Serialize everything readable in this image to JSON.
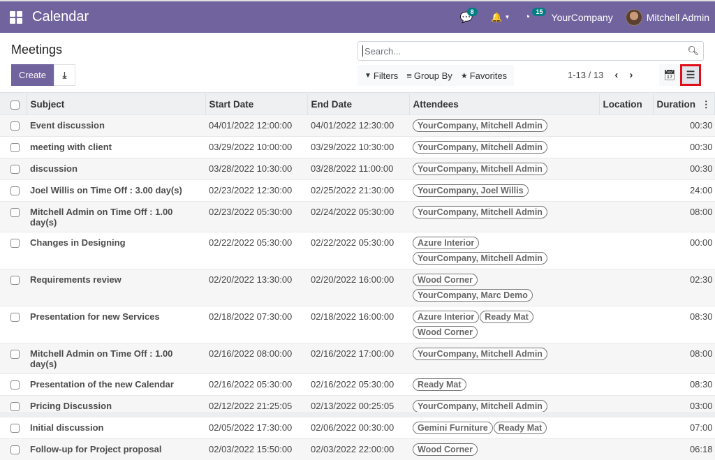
{
  "navbar": {
    "app_title": "Calendar",
    "messages_count": "8",
    "activities_count": "15",
    "company": "YourCompany",
    "user": "Mitchell Admin"
  },
  "control_panel": {
    "breadcrumb": "Meetings",
    "create_label": "Create",
    "search_placeholder": "Search...",
    "filters_label": "Filters",
    "group_by_label": "Group By",
    "favorites_label": "Favorites",
    "pager": "1-13 / 13",
    "active_view": "list"
  },
  "table": {
    "columns": [
      "Subject",
      "Start Date",
      "End Date",
      "Attendees",
      "Location",
      "Duration"
    ],
    "rows": [
      {
        "subject": "Event discussion",
        "start": "04/01/2022 12:00:00",
        "end": "04/01/2022 12:30:00",
        "attendees": [
          "YourCompany, Mitchell Admin"
        ],
        "location": "",
        "duration": "00:30"
      },
      {
        "subject": "meeting with client",
        "start": "03/29/2022 10:00:00",
        "end": "03/29/2022 10:30:00",
        "attendees": [
          "YourCompany, Mitchell Admin"
        ],
        "location": "",
        "duration": "00:30"
      },
      {
        "subject": "discussion",
        "start": "03/28/2022 10:30:00",
        "end": "03/28/2022 11:00:00",
        "attendees": [
          "YourCompany, Mitchell Admin"
        ],
        "location": "",
        "duration": "00:30"
      },
      {
        "subject": "Joel Willis on Time Off : 3.00 day(s)",
        "start": "02/23/2022 12:30:00",
        "end": "02/25/2022 21:30:00",
        "attendees": [
          "YourCompany, Joel Willis"
        ],
        "location": "",
        "duration": "24:00"
      },
      {
        "subject": "Mitchell Admin on Time Off : 1.00 day(s)",
        "start": "02/23/2022 05:30:00",
        "end": "02/24/2022 05:30:00",
        "attendees": [
          "YourCompany, Mitchell Admin"
        ],
        "location": "",
        "duration": "08:00"
      },
      {
        "subject": "Changes in Designing",
        "start": "02/22/2022 05:30:00",
        "end": "02/22/2022 05:30:00",
        "attendees": [
          "Azure Interior",
          "YourCompany, Mitchell Admin"
        ],
        "wrap": true,
        "location": "",
        "duration": "00:00"
      },
      {
        "subject": "Requirements review",
        "start": "02/20/2022 13:30:00",
        "end": "02/20/2022 16:00:00",
        "attendees": [
          "Wood Corner",
          "YourCompany, Marc Demo"
        ],
        "location": "",
        "duration": "02:30"
      },
      {
        "subject": "Presentation for new Services",
        "start": "02/18/2022 07:30:00",
        "end": "02/18/2022 16:00:00",
        "attendees": [
          "Azure Interior",
          "Ready Mat",
          "Wood Corner"
        ],
        "wrap": true,
        "location": "",
        "duration": "08:30"
      },
      {
        "subject": "Mitchell Admin on Time Off : 1.00 day(s)",
        "start": "02/16/2022 08:00:00",
        "end": "02/16/2022 17:00:00",
        "attendees": [
          "YourCompany, Mitchell Admin"
        ],
        "location": "",
        "duration": "08:00"
      },
      {
        "subject": "Presentation of the new Calendar",
        "start": "02/16/2022 05:30:00",
        "end": "02/16/2022 05:30:00",
        "attendees": [
          "Ready Mat"
        ],
        "location": "",
        "duration": "08:30"
      },
      {
        "subject": "Pricing Discussion",
        "start": "02/12/2022 21:25:05",
        "end": "02/13/2022 00:25:05",
        "attendees": [
          "YourCompany, Mitchell Admin"
        ],
        "location": "",
        "duration": "03:00"
      },
      {
        "subject": "Initial discussion",
        "start": "02/05/2022 17:30:00",
        "end": "02/06/2022 00:30:00",
        "attendees": [
          "Gemini Furniture",
          "Ready Mat"
        ],
        "location": "",
        "duration": "07:00"
      },
      {
        "subject": "Follow-up for Project proposal",
        "start": "02/03/2022 15:50:00",
        "end": "02/03/2022 22:00:00",
        "attendees": [
          "Wood Corner"
        ],
        "location": "",
        "duration": "06:18"
      }
    ]
  }
}
